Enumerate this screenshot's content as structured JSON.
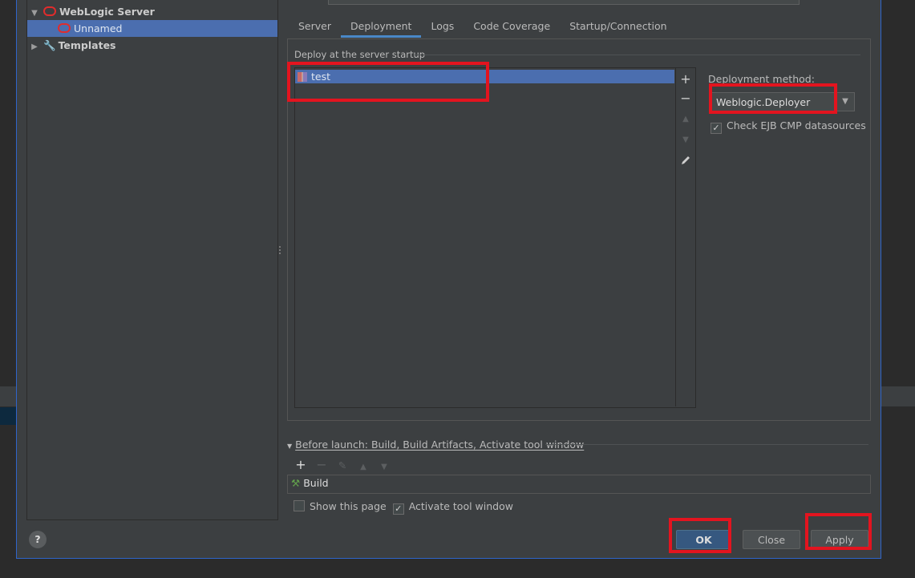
{
  "tree": {
    "group_label": "WebLogic Server",
    "child_label": "Unnamed",
    "templates_label": "Templates"
  },
  "tabs": [
    {
      "label": "Server"
    },
    {
      "label": "Deployment"
    },
    {
      "label": "Logs"
    },
    {
      "label": "Code Coverage"
    },
    {
      "label": "Startup/Connection"
    }
  ],
  "deployment": {
    "section_title": "Deploy at the server startup",
    "items": [
      {
        "label": "test"
      }
    ],
    "method_label": "Deployment method:",
    "method_value": "Weblogic.Deployer",
    "check_ejb_label": "Check EJB CMP datasources",
    "check_ejb_checked": true
  },
  "before_launch": {
    "title": "Before launch: Build, Build Artifacts, Activate tool window",
    "tasks": [
      {
        "label": "Build",
        "icon": "hammer-icon"
      }
    ]
  },
  "options": {
    "show_page_label": "Show this page",
    "show_page_checked": false,
    "activate_tool_window_label": "Activate tool window",
    "activate_tool_window_checked": true
  },
  "footer": {
    "help_label": "?",
    "ok_label": "OK",
    "close_label": "Close",
    "apply_label": "Apply"
  },
  "colors": {
    "selection": "#4b6eaf",
    "highlight_box": "#e3141f",
    "default_button": "#365880"
  }
}
